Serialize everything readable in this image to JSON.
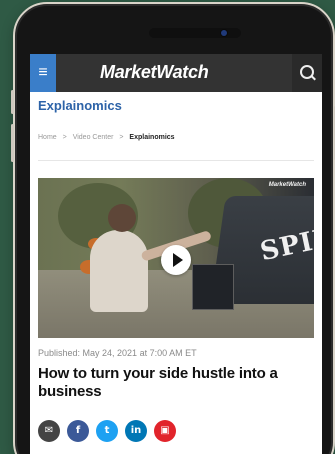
{
  "app": {
    "brand_title": "MarketWatch"
  },
  "header": {
    "menu_icon": "menu-icon",
    "search_icon": "search-icon"
  },
  "page": {
    "section_title": "Explainomics",
    "breadcrumb": [
      "Home",
      "Video Center",
      "Explainomics"
    ],
    "published": "Published: May 24, 2021 at 7:00 AM ET",
    "headline": "How to turn your side hustle into a business"
  },
  "video": {
    "watermark": "MarketWatch",
    "sign_text": "SPIL",
    "play_icon": "play-icon"
  },
  "share": {
    "items": [
      {
        "label": "✉",
        "name": "email-share-button",
        "color": "#444444"
      },
      {
        "label": "f",
        "name": "facebook-share-button",
        "color": "#3b5998"
      },
      {
        "label": "t",
        "name": "twitter-share-button",
        "color": "#1da1f2"
      },
      {
        "label": "in",
        "name": "linkedin-share-button",
        "color": "#0077b5"
      },
      {
        "label": "▣",
        "name": "flipboard-share-button",
        "color": "#e1242b"
      }
    ]
  },
  "colors": {
    "background": "#2f5a45",
    "topbar": "#333333",
    "menu_accent": "#3a7ec9",
    "section_title": "#2d63a8"
  }
}
